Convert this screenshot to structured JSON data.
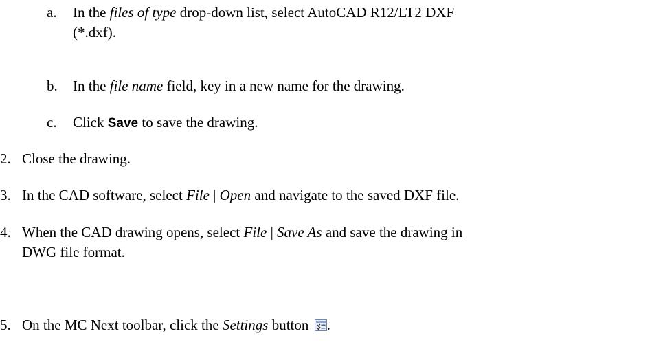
{
  "steps": [
    {
      "marker": "a.",
      "parts": [
        {
          "t": "In the "
        },
        {
          "t": "files of type",
          "s": "i"
        },
        {
          "t": " drop-down list, select AutoCAD R12/LT2 DXF"
        }
      ],
      "line2": "(*.dxf)."
    },
    {
      "marker": "b.",
      "parts": [
        {
          "t": "In the "
        },
        {
          "t": "file name",
          "s": "i"
        },
        {
          "t": " field, key in a new name for the drawing."
        }
      ]
    },
    {
      "marker": "c.",
      "parts": [
        {
          "t": "Click "
        },
        {
          "t": "Save",
          "s": "b"
        },
        {
          "t": " to save the drawing."
        }
      ]
    },
    {
      "marker": "2.",
      "parts": [
        {
          "t": "Close the drawing."
        }
      ]
    },
    {
      "marker": "3.",
      "parts": [
        {
          "t": "In the CAD software, select "
        },
        {
          "t": "File",
          "s": "i"
        },
        {
          "t": " | "
        },
        {
          "t": "Open",
          "s": "i"
        },
        {
          "t": " and navigate to the saved DXF file."
        }
      ]
    },
    {
      "marker": "4.",
      "parts": [
        {
          "t": "When the CAD drawing opens, select "
        },
        {
          "t": "File",
          "s": "i"
        },
        {
          "t": " | "
        },
        {
          "t": "Save As",
          "s": "i"
        },
        {
          "t": " and save the drawing in"
        }
      ],
      "line2": "DWG file format."
    },
    {
      "marker": "5.",
      "parts": [
        {
          "t": "On the MC Next toolbar, click the "
        },
        {
          "t": "Settings",
          "s": "i"
        },
        {
          "t": " button"
        }
      ],
      "icon": "settings-icon",
      "trailing": "."
    }
  ]
}
